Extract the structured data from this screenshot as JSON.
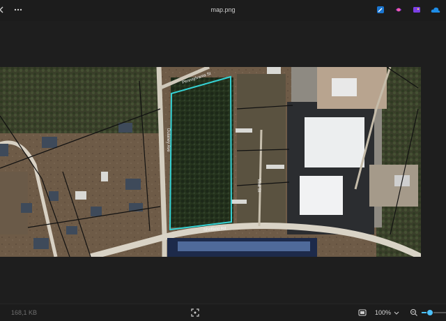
{
  "window": {
    "title": "map.png"
  },
  "image": {
    "road_labels": {
      "upper_left": "Pennsylvania St",
      "left_vertical": "Dulaney Ave",
      "center_vertical": "Vine St",
      "bottom": "Sheffield Rd"
    }
  },
  "statusbar": {
    "file_size": "168,1 KB",
    "zoom_label": "100%",
    "zoom_fraction": 0.3
  },
  "icons": {
    "top_left": [
      "back-arrow-icon",
      "more-options-icon"
    ],
    "top_right": [
      "edit-icon",
      "clipchamp-icon",
      "photos-app-icon",
      "onedrive-icon"
    ],
    "bottom": [
      "fit-screen-icon",
      "view-mode-icon",
      "zoom-out-icon"
    ]
  },
  "colors": {
    "parcel_outline": "#35d3d5",
    "accent": "#4cc2ff"
  }
}
